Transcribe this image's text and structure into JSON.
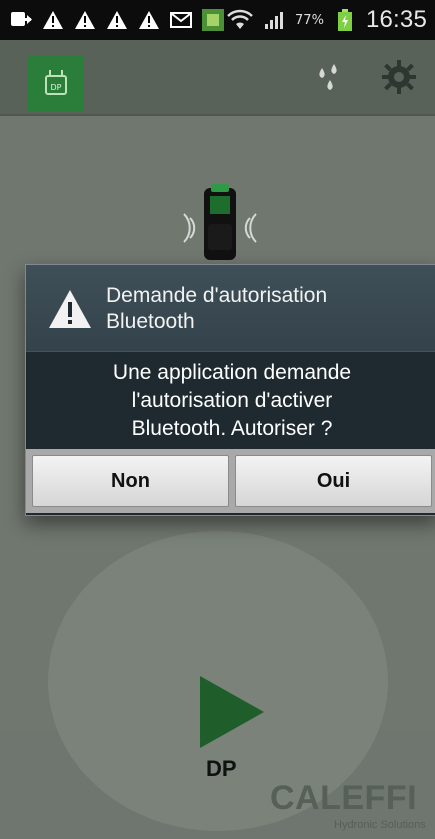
{
  "status_bar": {
    "battery_percent": "77%",
    "time": "16:35",
    "icons": [
      "screen-mirror-icon",
      "warning-icon",
      "warning-icon",
      "warning-icon",
      "warning-icon",
      "mail-icon",
      "app-notification-icon",
      "wifi-icon",
      "signal-icon",
      "battery-charging-icon"
    ]
  },
  "app_header": {
    "logo_text": "DP",
    "icons": [
      "drops-icon",
      "gear-icon"
    ]
  },
  "main": {
    "device_icon": "handheld-device-icon",
    "play_label": "DP",
    "brand": {
      "name": "CALEFFI",
      "tagline": "Hydronic Solutions"
    }
  },
  "dialog": {
    "title": "Demande d'autorisation\nBluetooth",
    "message": "Une application demande\nl'autorisation d'activer\nBluetooth. Autoriser ?",
    "buttons": {
      "negative": "Non",
      "positive": "Oui"
    }
  },
  "colors": {
    "dim_bg": "#70776f",
    "accent_green": "#1f5d2b",
    "dialog_bg": "#1f2a30",
    "dialog_title_bg": "#3f4f58"
  }
}
